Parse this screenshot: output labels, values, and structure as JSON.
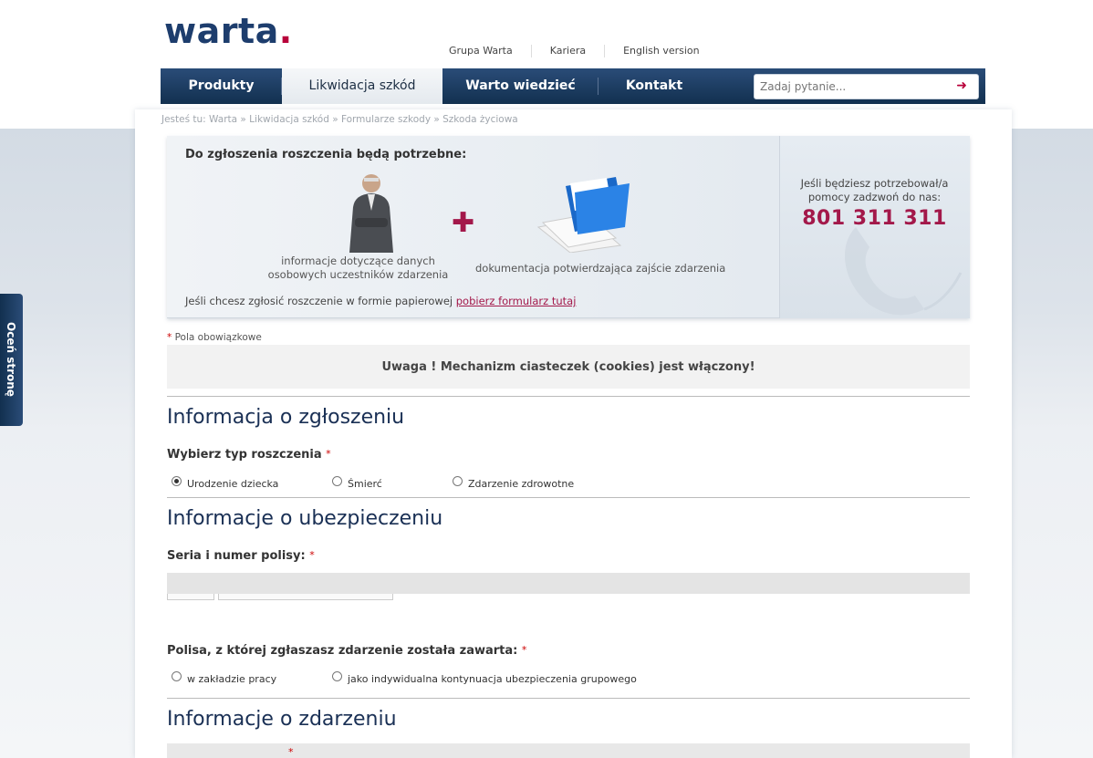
{
  "logo": {
    "text": "warta",
    "dot": "."
  },
  "top_links": [
    "Grupa Warta",
    "Kariera",
    "English version"
  ],
  "nav": {
    "items": [
      "Produkty",
      "Likwidacja szkód",
      "Warto wiedzieć",
      "Kontakt"
    ],
    "active_index": 1
  },
  "search": {
    "placeholder": "Zadaj pytanie...",
    "arrow": "➜"
  },
  "breadcrumb": "Jesteś tu: Warta » Likwidacja szkód » Formularze szkody » Szkoda życiowa",
  "infobox": {
    "title": "Do zgłoszenia roszczenia będą potrzebne:",
    "caption_left": "informacje dotyczące danych osobowych uczestników zdarzenia",
    "caption_right": "dokumentacja potwierdzająca zajście zdarzenia",
    "paper_text": "Jeśli chcesz zgłosić roszczenie w formie papierowej",
    "paper_link": "pobierz formularz tutaj",
    "help_text": "Jeśli będziesz potrzebował/a pomocy zadzwoń do nas:",
    "phone": "801 311 311"
  },
  "required_note": "Pola obowiązkowe",
  "cookie_notice": "Uwaga ! Mechanizm ciasteczek (cookies) jest włączony!",
  "sections": {
    "zgloszenie": {
      "title": "Informacja o zgłoszeniu",
      "claim_type_label": "Wybierz typ roszczenia",
      "options": [
        "Urodzenie dziecka",
        "Śmierć",
        "Zdarzenie zdrowotne"
      ],
      "selected": "Urodzenie dziecka"
    },
    "ubezpieczenie": {
      "title": "Informacje o ubezpieczeniu",
      "policy_label": "Seria i numer polisy:",
      "policy_type_label": "Polisa, z której zgłaszasz zdarzenie została zawarta:",
      "policy_options": [
        "w zakładzie pracy",
        "jako indywidualna kontynuacja ubezpieczenia grupowego"
      ]
    },
    "zdarzenie": {
      "title": "Informacje o zdarzeniu"
    }
  },
  "side_tab": "Oceń stronę",
  "colors": {
    "brand_navy": "#1d3d6d",
    "brand_red": "#b8003a",
    "phone_red": "#a3184a"
  }
}
